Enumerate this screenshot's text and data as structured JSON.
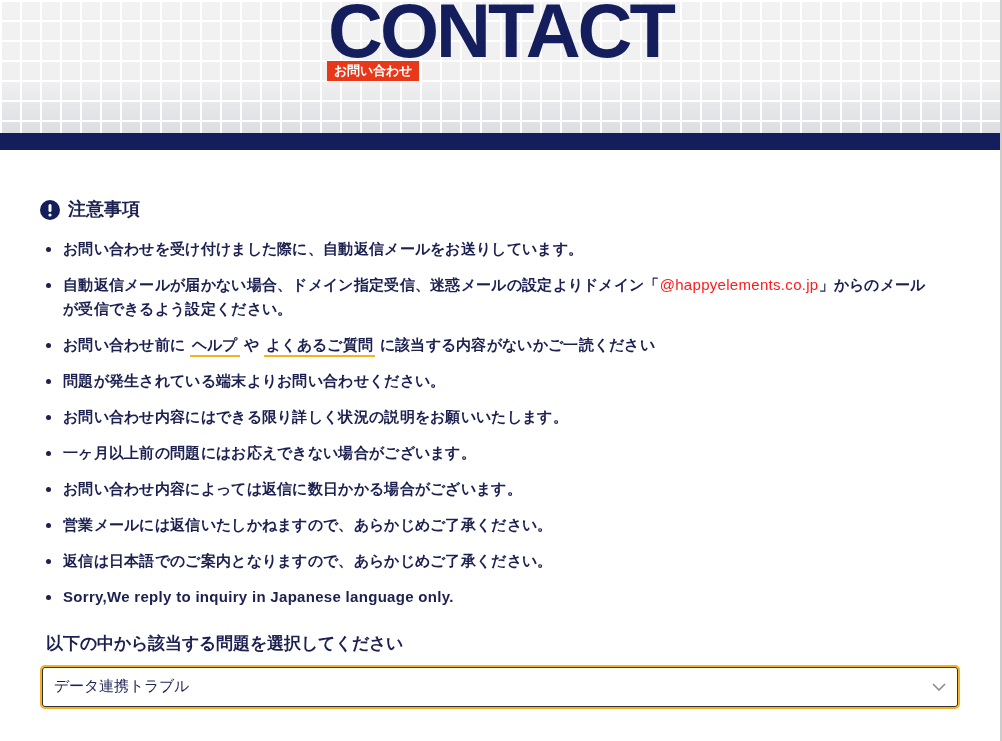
{
  "header": {
    "title": "CONTACT",
    "subtitle": "お問い合わせ"
  },
  "notice": {
    "heading": "注意事項",
    "items": [
      [
        {
          "kind": "text",
          "text": "お問い合わせを受け付けました際に、自動返信メールをお送りしています。"
        }
      ],
      [
        {
          "kind": "text",
          "text": "自動返信メールが届かない場合、ドメイン指定受信、迷惑メールの設定よりドメイン「"
        },
        {
          "kind": "highlight",
          "text": "@happyelements.co.jp"
        },
        {
          "kind": "text",
          "text": "」からのメールが受信できるよう設定ください。"
        }
      ],
      [
        {
          "kind": "text",
          "text": "お問い合わせ前に "
        },
        {
          "kind": "link",
          "text": "ヘルプ"
        },
        {
          "kind": "text",
          "text": " や "
        },
        {
          "kind": "link",
          "text": "よくあるご質問"
        },
        {
          "kind": "text",
          "text": " に該当する内容がないかご一読ください"
        }
      ],
      [
        {
          "kind": "text",
          "text": "問題が発生されている端末よりお問い合わせください。"
        }
      ],
      [
        {
          "kind": "text",
          "text": "お問い合わせ内容にはできる限り詳しく状況の説明をお願いいたします。"
        }
      ],
      [
        {
          "kind": "text",
          "text": "一ヶ月以上前の問題にはお応えできない場合がございます。"
        }
      ],
      [
        {
          "kind": "text",
          "text": "お問い合わせ内容によっては返信に数日かかる場合がございます。"
        }
      ],
      [
        {
          "kind": "text",
          "text": "営業メールには返信いたしかねますので、あらかじめご了承ください。"
        }
      ],
      [
        {
          "kind": "text",
          "text": "返信は日本語でのご案内となりますので、あらかじめご了承ください。"
        }
      ],
      [
        {
          "kind": "text",
          "text": "Sorry,We reply to inquiry in Japanese language only."
        }
      ]
    ]
  },
  "problem_select": {
    "label": "以下の中から該当する問題を選択してください",
    "value": "データ連携トラブル"
  }
}
